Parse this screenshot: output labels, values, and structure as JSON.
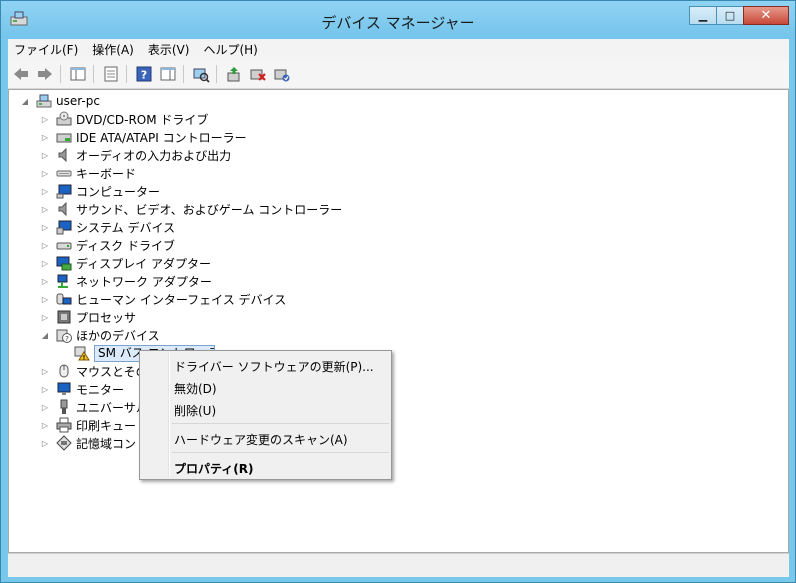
{
  "window": {
    "title": "デバイス マネージャー"
  },
  "menu": {
    "items": [
      "ファイル(F)",
      "操作(A)",
      "表示(V)",
      "ヘルプ(H)"
    ]
  },
  "tree": {
    "root": "user-pc",
    "items": [
      "DVD/CD-ROM ドライブ",
      "IDE ATA/ATAPI コントローラー",
      "オーディオの入力および出力",
      "キーボード",
      "コンピューター",
      "サウンド、ビデオ、およびゲーム コントローラー",
      "システム デバイス",
      "ディスク ドライブ",
      "ディスプレイ アダプター",
      "ネットワーク アダプター",
      "ヒューマン インターフェイス デバイス",
      "プロセッサ",
      "ほかのデバイス",
      "SM バス コントローラー",
      "マウスとそのほかのポインティング デバイス",
      "モニター",
      "ユニバーサル シリアル バス コントローラー",
      "印刷キュー",
      "記憶域コントローラー"
    ]
  },
  "context_menu": {
    "update": "ドライバー ソフトウェアの更新(P)...",
    "disable": "無効(D)",
    "uninstall": "削除(U)",
    "scan": "ハードウェア変更のスキャン(A)",
    "properties": "プロパティ(R)"
  }
}
